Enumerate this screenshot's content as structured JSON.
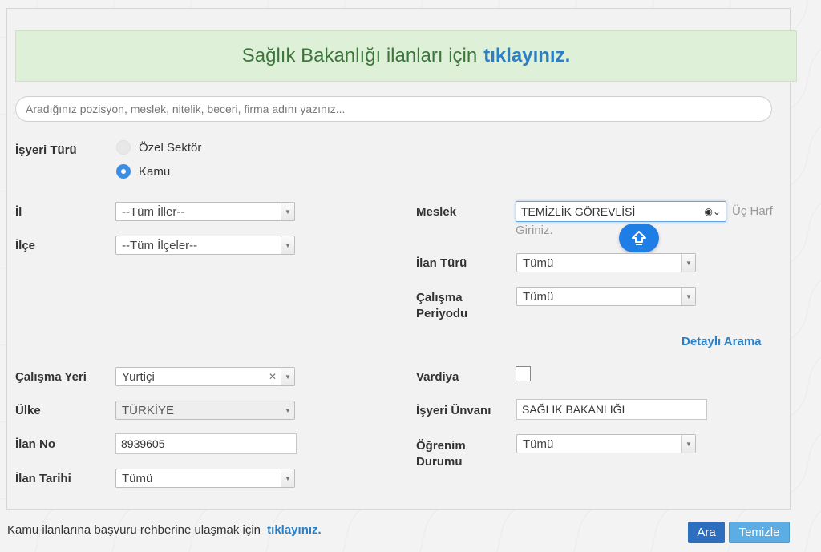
{
  "banner": {
    "text": "Sağlık Bakanlığı ilanları için",
    "link": "tıklayınız."
  },
  "search": {
    "placeholder": "Aradığınız pozisyon, meslek, nitelik, beceri, firma adını yazınız..."
  },
  "isyeri_turu": {
    "label": "İşyeri Türü",
    "options": [
      {
        "label": "Özel Sektör",
        "selected": false
      },
      {
        "label": "Kamu",
        "selected": true
      }
    ]
  },
  "left": {
    "il": {
      "label": "İl",
      "value": "--Tüm İller--"
    },
    "ilce": {
      "label": "İlçe",
      "value": "--Tüm İlçeler--"
    },
    "calisma_yeri": {
      "label": "Çalışma Yeri",
      "value": "Yurtiçi"
    },
    "ulke": {
      "label": "Ülke",
      "value": "TÜRKİYE"
    },
    "ilan_no": {
      "label": "İlan No",
      "value": "8939605"
    },
    "ilan_tarihi": {
      "label": "İlan Tarihi",
      "value": "Tümü"
    }
  },
  "right": {
    "meslek": {
      "label": "Meslek",
      "value": "TEMİZLİK GÖREVLİSİ",
      "hint_line1": "Üç Harf",
      "hint_line2": "Giriniz."
    },
    "ilan_turu": {
      "label": "İlan Türü",
      "value": "Tümü"
    },
    "calisma_periyodu": {
      "label_line1": "Çalışma",
      "label_line2": "Periyodu",
      "value": "Tümü"
    },
    "detayli_arama": "Detaylı Arama",
    "vardiya": {
      "label": "Vardiya",
      "checked": false
    },
    "isyeri_unvani": {
      "label": "İşyeri Ünvanı",
      "value": "SAĞLIK BAKANLIĞI"
    },
    "ogrenim_durumu": {
      "label_line1": "Öğrenim",
      "label_line2": "Durumu",
      "value": "Tümü"
    }
  },
  "footer": {
    "text": "Kamu ilanlarına başvuru rehberine ulaşmak için",
    "link": "tıklayınız.",
    "ara_button": "Ara",
    "temizle_button": "Temizle"
  },
  "colors": {
    "accent": "#2a7fc5",
    "banner_bg": "#dff0d8",
    "banner_text": "#3c763d",
    "radio_on": "#3a8ee6",
    "floating_btn": "#1f7de6"
  },
  "icons": {
    "floating": "double-chevron-up-icon",
    "meslek_field": "person-circle-icon"
  }
}
